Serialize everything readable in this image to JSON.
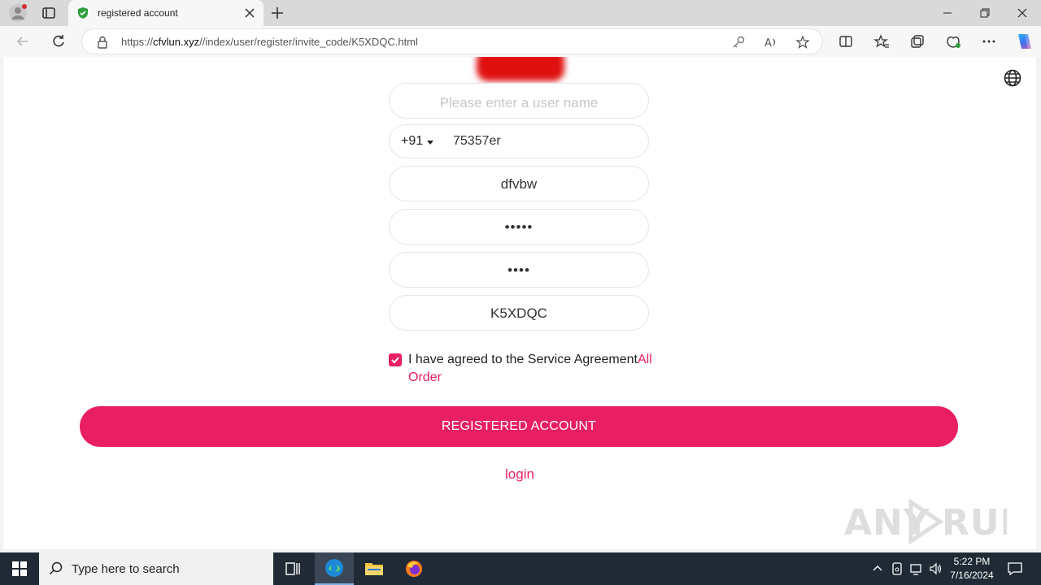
{
  "browser": {
    "tab_title": "registered account",
    "url_prefix": "https://",
    "url_host": "cfvlun.xyz",
    "url_path": "//index/user/register/invite_code/K5XDQC.html"
  },
  "form": {
    "username_placeholder": "Please enter a user name",
    "country_code": "+91",
    "phone_value": "75357er",
    "name_value": "dfvbw",
    "password_value": "•••••",
    "confirm_password_value": "••••",
    "invite_code_value": "K5XDQC",
    "agree_text": "I have agreed to the Service Agreement",
    "agree_link": "All Order",
    "agree_checked": true,
    "submit_label": "REGISTERED ACCOUNT",
    "login_label": "login"
  },
  "watermark": "ANY RUN",
  "taskbar": {
    "search_placeholder": "Type here to search",
    "time": "5:22 PM",
    "date": "7/16/2024"
  },
  "colors": {
    "accent": "#e91e63",
    "taskbar": "#1f2a36"
  }
}
